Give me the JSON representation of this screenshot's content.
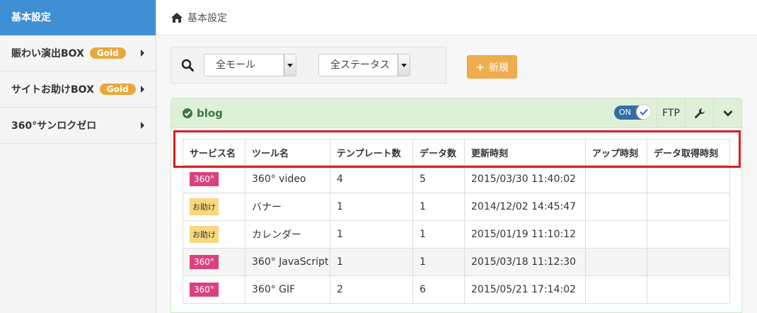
{
  "sidebar": {
    "active": "基本設定",
    "items": [
      {
        "label": "賑わい演出BOX",
        "badge": "Gold"
      },
      {
        "label": "サイトお助けBOX",
        "badge": "Gold"
      },
      {
        "label": "360°サンロクゼロ",
        "badge": ""
      }
    ]
  },
  "breadcrumb": {
    "label": "基本設定"
  },
  "filters": {
    "mall": "全モール",
    "status": "全ステータス"
  },
  "new_button": {
    "label": "新規"
  },
  "panel": {
    "title": "blog",
    "toggle": "ON",
    "ftp": "FTP"
  },
  "table": {
    "headers": [
      "サービス名",
      "ツール名",
      "テンプレート数",
      "データ数",
      "更新時刻",
      "アップ時刻",
      "データ取得時刻"
    ],
    "rows": [
      {
        "service": "360°",
        "tool": "360° video",
        "templates": "4",
        "data": "5",
        "updated": "2015/03/30 11:40:02",
        "uploaded": "",
        "fetched": ""
      },
      {
        "service": "お助け",
        "tool": "バナー",
        "templates": "1",
        "data": "1",
        "updated": "2014/12/02 14:45:47",
        "uploaded": "",
        "fetched": ""
      },
      {
        "service": "お助け",
        "tool": "カレンダー",
        "templates": "1",
        "data": "1",
        "updated": "2015/01/19 11:10:12",
        "uploaded": "",
        "fetched": ""
      },
      {
        "service": "360°",
        "tool": "360° JavaScript",
        "templates": "1",
        "data": "1",
        "updated": "2015/03/18 11:12:30",
        "uploaded": "",
        "fetched": ""
      },
      {
        "service": "360°",
        "tool": "360° GIF",
        "templates": "2",
        "data": "6",
        "updated": "2015/05/21 17:14:02",
        "uploaded": "",
        "fetched": ""
      }
    ]
  },
  "colors": {
    "accent": "#3f8fd4",
    "gold": "#e9a83b",
    "success": "#3c763d",
    "tag360": "#d8427f",
    "tagHelp": "#f9d77d",
    "highlight": "#d61e1e"
  }
}
